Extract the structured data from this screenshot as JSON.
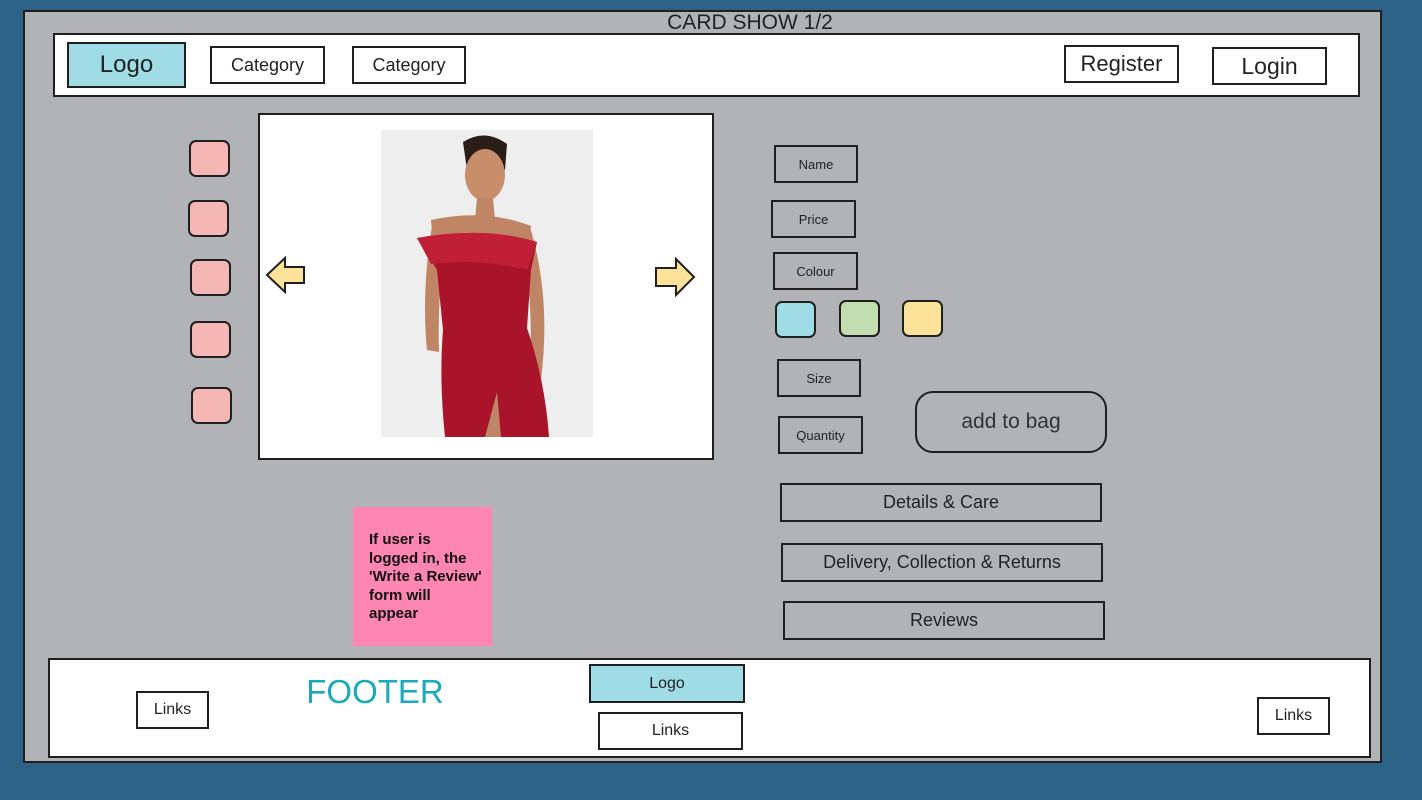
{
  "page_title": "CARD SHOW 1/2",
  "header": {
    "logo": "Logo",
    "categories": [
      "Category",
      "Category"
    ],
    "register": "Register",
    "login": "Login"
  },
  "gallery": {
    "thumbnail_count": 5,
    "prev_icon": "arrow-left-icon",
    "next_icon": "arrow-right-icon",
    "image": "red strapless dress product photo"
  },
  "product": {
    "name": "Name",
    "price": "Price",
    "colour": "Colour",
    "swatches": [
      "#9fdce6",
      "#c2ddb0",
      "#fde29a"
    ],
    "size": "Size",
    "quantity": "Quantity",
    "add_to_bag": "add to bag"
  },
  "accordions": [
    "Details & Care",
    "Delivery, Collection & Returns",
    "Reviews"
  ],
  "sticky_note": "If user is logged in, the 'Write a Review' form will appear",
  "footer": {
    "title": "FOOTER",
    "logo": "Logo",
    "links_left": "Links",
    "links_center": "Links",
    "links_right": "Links"
  }
}
